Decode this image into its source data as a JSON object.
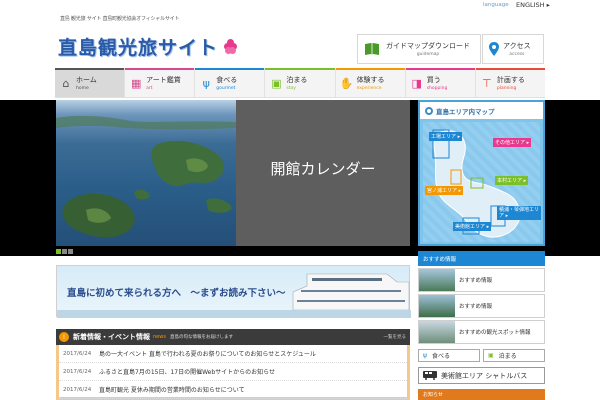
{
  "header": {
    "tagline": "直島 観光旅 サイト 直島町観光協会オフィシャルサイト",
    "language_label": "language",
    "language_current": "ENGLISH ▸",
    "logo_text": "直島観光旅サイト"
  },
  "utility": {
    "guidemap_jp": "ガイドマップダウンロード",
    "guidemap_en": "guidemap",
    "access_jp": "アクセス",
    "access_en": "access"
  },
  "nav": [
    {
      "jp": "ホーム",
      "en": "home",
      "color": "#555555",
      "icon": "home-icon"
    },
    {
      "jp": "アート鑑賞",
      "en": "art",
      "color": "#d44a8c",
      "icon": "art-icon"
    },
    {
      "jp": "食べる",
      "en": "gourmet",
      "color": "#1e87d4",
      "icon": "fork-knife-icon"
    },
    {
      "jp": "泊まる",
      "en": "stay",
      "color": "#7bbf2a",
      "icon": "suitcase-icon"
    },
    {
      "jp": "体験する",
      "en": "experience",
      "color": "#f39800",
      "icon": "experience-icon"
    },
    {
      "jp": "買う",
      "en": "shopping",
      "color": "#e8398e",
      "icon": "shopping-icon"
    },
    {
      "jp": "計画する",
      "en": "planning",
      "color": "#e94b35",
      "icon": "signpost-icon"
    }
  ],
  "hero": {
    "caption": "開館カレンダー"
  },
  "map": {
    "title": "直島エリア内マップ",
    "labels": [
      {
        "text": "工場エリア ▸",
        "color": "#1e87d4"
      },
      {
        "text": "その他エリア ▸",
        "color": "#e8398e"
      },
      {
        "text": "本村エリア ▸",
        "color": "#7bbf2a"
      },
      {
        "text": "宮ノ浦エリア ▸",
        "color": "#f39800"
      },
      {
        "text": "積浦・琴弾地エリア ▸",
        "color": "#1e87d4"
      },
      {
        "text": "美術館エリア ▸",
        "color": "#1e87d4"
      }
    ]
  },
  "banner": {
    "title": "直島に初めて来られる方へ　～まずお読み下さい～"
  },
  "news": {
    "index": "!",
    "title": "新着情報・イベント情報",
    "en": "news",
    "subtitle": "直島の旬な情報をお届けします",
    "more": "一覧を見る",
    "rows": [
      {
        "date": "2017/6/24",
        "text": "島の一大イベント 直島で行われる夏のお祭りについてのお知らせとスケジュール"
      },
      {
        "date": "2017/6/24",
        "text": "ふるさと直島7月の15日、17日の開催Webサイトからのお知らせ"
      },
      {
        "date": "2017/6/24",
        "text": "直島町観光 夏休み期間の営業時間のお知らせについて"
      }
    ]
  },
  "right": {
    "heading": "おすすめ情報",
    "items": [
      "おすすめ情報",
      "おすすめ情報",
      "おすすめの観光スポット情報"
    ],
    "eat": "食べる",
    "stay": "泊まる",
    "shuttle": "美術館エリア シャトルバス",
    "heading2": "お知らせ"
  }
}
